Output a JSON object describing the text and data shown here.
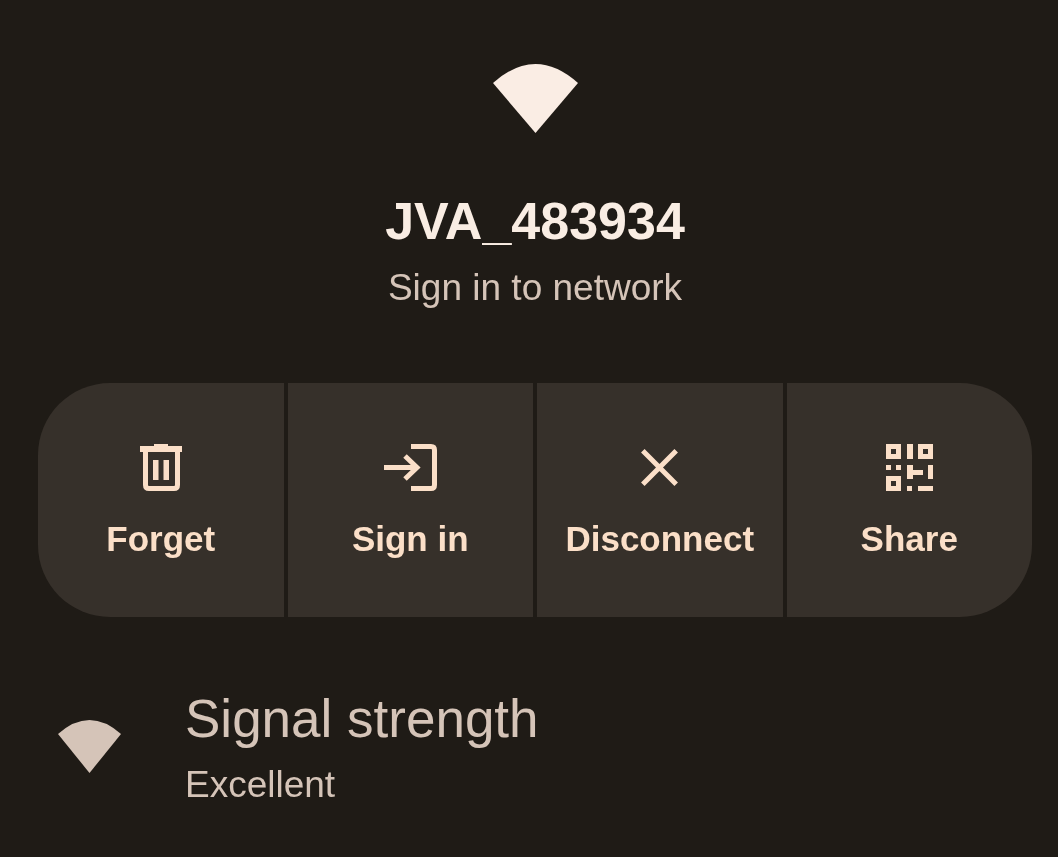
{
  "network": {
    "title": "JVA_483934",
    "status": "Sign in to network"
  },
  "actions": [
    {
      "label": "Forget",
      "kind": "forget"
    },
    {
      "label": "Sign in",
      "kind": "sign_in"
    },
    {
      "label": "Disconnect",
      "kind": "disconnect"
    },
    {
      "label": "Share",
      "kind": "share"
    }
  ],
  "details": [
    {
      "title": "Signal strength",
      "value": "Excellent"
    }
  ]
}
